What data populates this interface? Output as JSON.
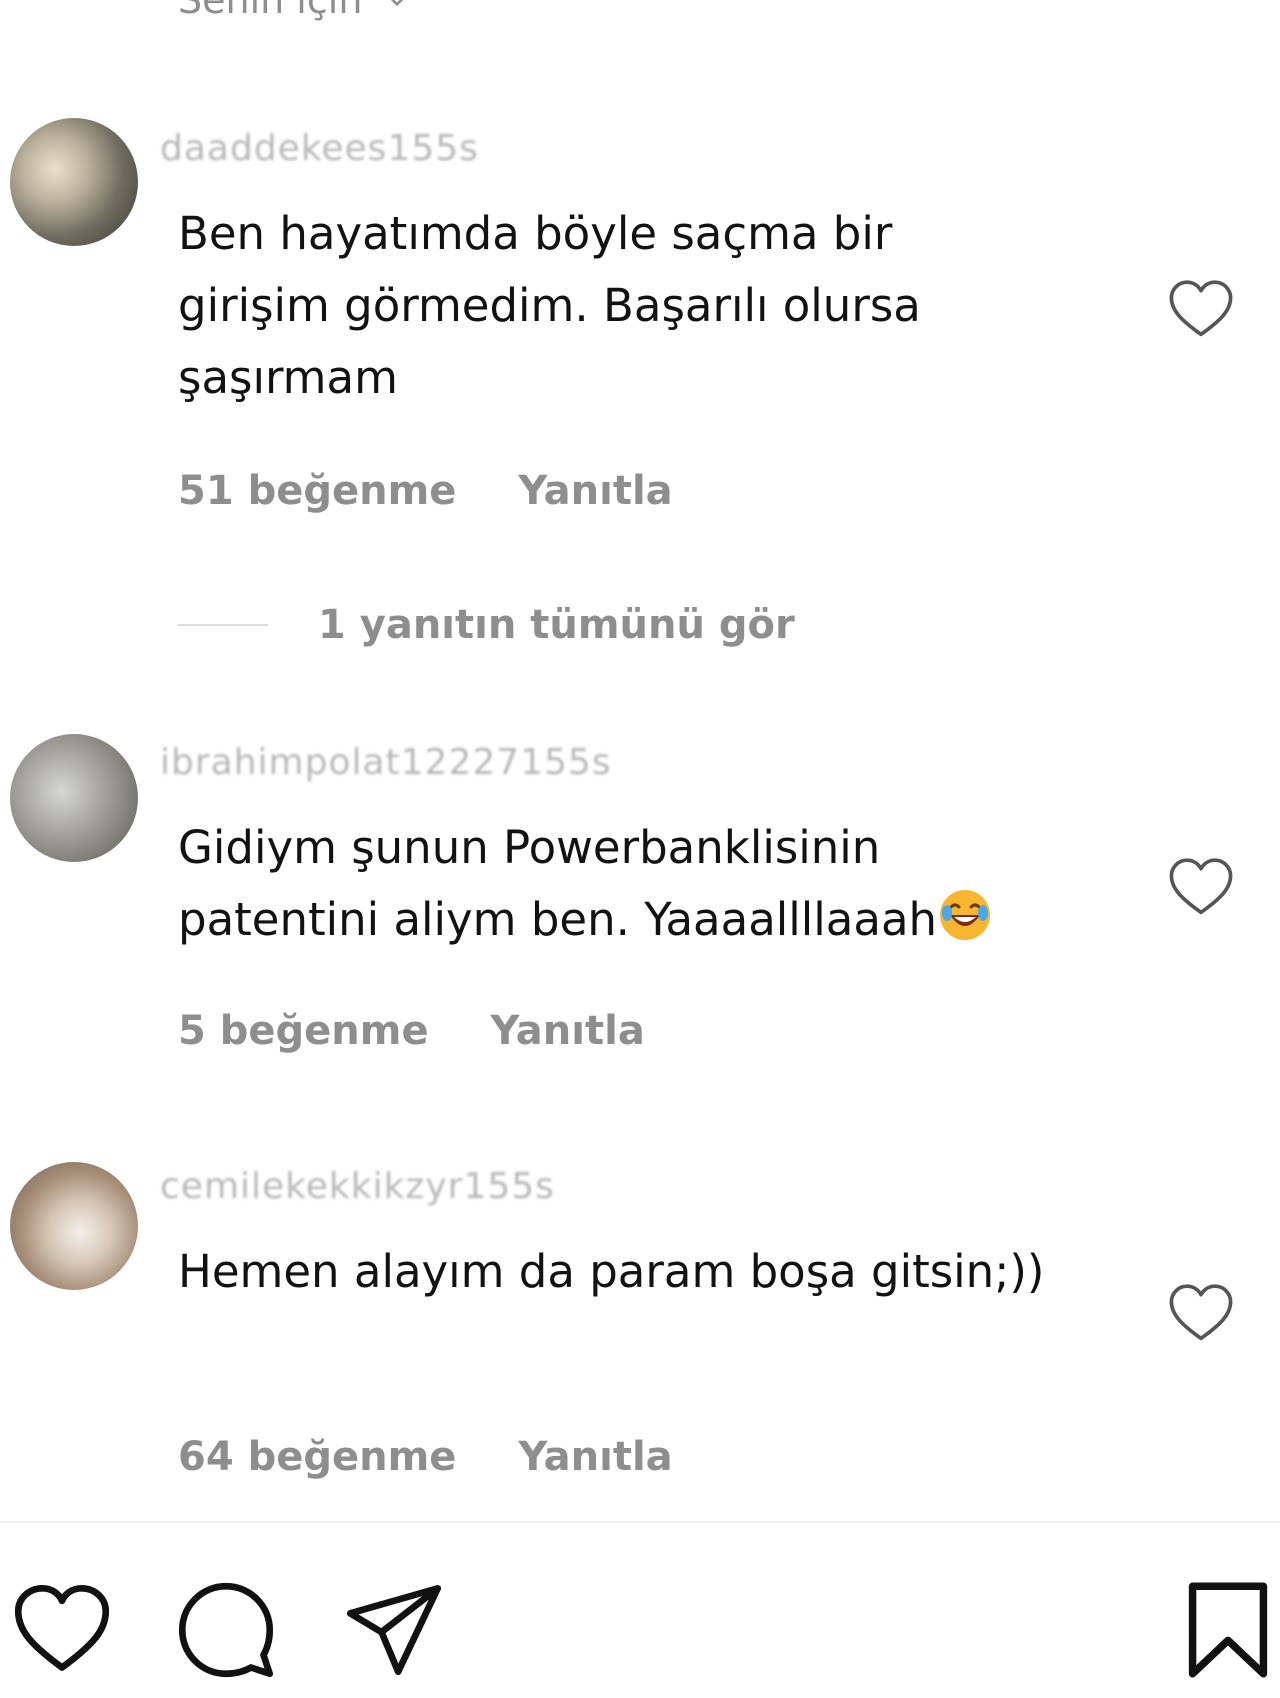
{
  "sort": {
    "label": "Senin için"
  },
  "comments": [
    {
      "username": "daaddekees155s",
      "text": "Ben hayatımda böyle saçma bir girişim görmedim. Başarılı olursa şaşırmam",
      "likes": "51 beğenme",
      "reply": "Yanıtla"
    },
    {
      "username": "ibrahimpolat12227155s",
      "text": "Gidiym şunun Powerbanklisinin patentini aliym ben. Yaaaallllaaah",
      "emoji": "rolling-on-the-floor-laughing-icon",
      "likes": "5 beğenme",
      "reply": "Yanıtla"
    },
    {
      "username": "cemilekekkikzyr155s",
      "text": "Hemen alayım da param boşa gitsin;))",
      "likes": "64 beğenme",
      "reply": "Yanıtla"
    }
  ],
  "replies_link": "1 yanıtın tümünü gör",
  "action_bar": {
    "icons": [
      "heart-icon",
      "comment-icon",
      "share-icon",
      "bookmark-icon"
    ]
  },
  "colors": {
    "text": "#121212",
    "muted": "#8e8e8e",
    "divider": "#efefef"
  }
}
